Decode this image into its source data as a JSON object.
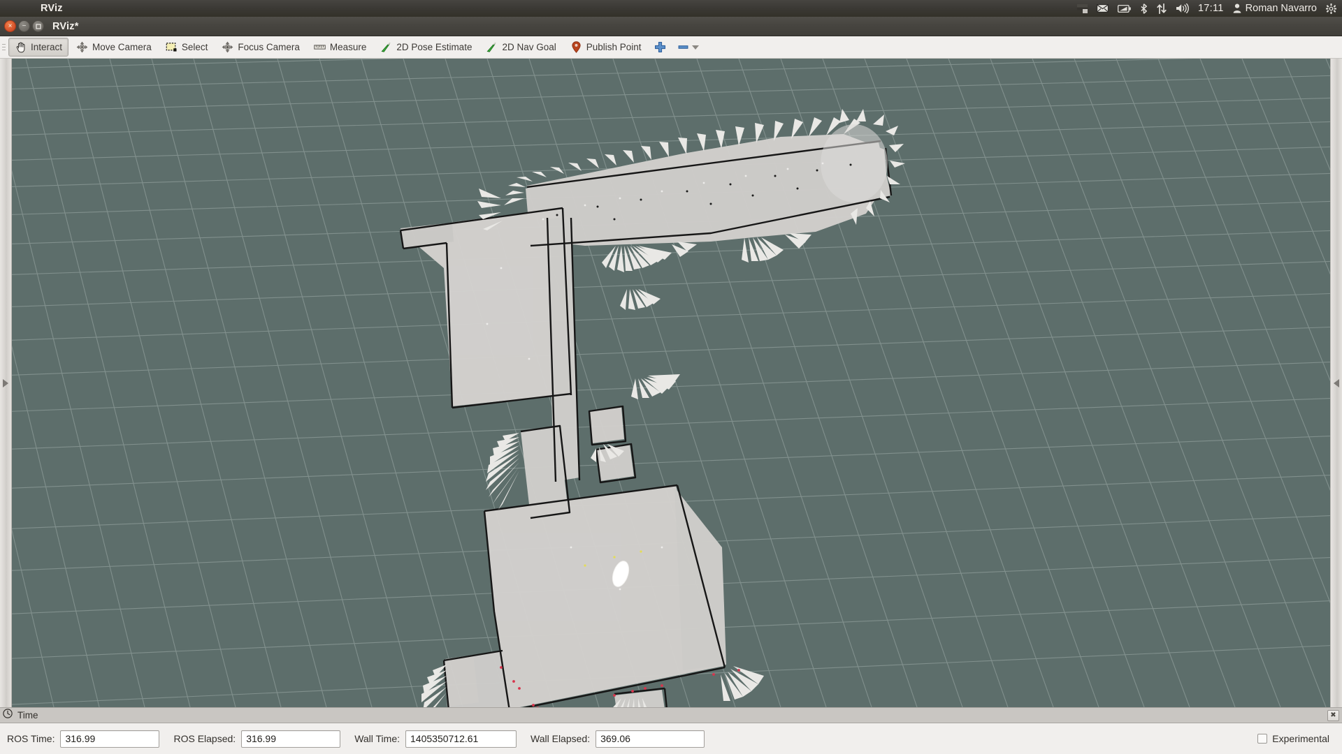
{
  "unity_panel": {
    "app_name": "RViz",
    "tray": {
      "icons": [
        {
          "name": "display-icon",
          "glyph": "display"
        },
        {
          "name": "mail-icon",
          "glyph": "envelope"
        },
        {
          "name": "battery-icon",
          "glyph": "battery"
        },
        {
          "name": "bluetooth-icon",
          "glyph": "bluetooth"
        },
        {
          "name": "network-icon",
          "glyph": "updown-arrows"
        },
        {
          "name": "volume-icon",
          "glyph": "speaker"
        }
      ],
      "clock": "17:11",
      "user_icon": "user-icon",
      "user_name": "Roman Navarro",
      "settings_icon": "gear-icon"
    }
  },
  "window": {
    "title": "RViz*",
    "controls": {
      "close": "×",
      "minimize": "−",
      "maximize": "□"
    }
  },
  "toolbar": {
    "items": [
      {
        "label": "Interact",
        "icon": "hand-cursor-icon",
        "active": true
      },
      {
        "label": "Move Camera",
        "icon": "move-camera-icon",
        "active": false
      },
      {
        "label": "Select",
        "icon": "select-rect-icon",
        "active": false
      },
      {
        "label": "Focus Camera",
        "icon": "focus-camera-icon",
        "active": false
      },
      {
        "label": "Measure",
        "icon": "ruler-icon",
        "active": false
      },
      {
        "label": "2D Pose Estimate",
        "icon": "green-arrow-icon",
        "active": false
      },
      {
        "label": "2D Nav Goal",
        "icon": "green-arrow-icon",
        "active": false
      },
      {
        "label": "Publish Point",
        "icon": "map-pin-icon",
        "active": false
      }
    ],
    "add_tool_icon": "plus-icon",
    "remove_tool_icon": "minus-icon",
    "dropdown_icon": "chevron-down-icon"
  },
  "viewport": {
    "background_color": "#5d6e6b",
    "grid_color": "#8e9c99",
    "map_free_color": "#d2d0cd",
    "map_occupied_color": "#151515",
    "scan_point_color": "#e9e8e5",
    "robot_color": "#ffffff",
    "marker_color": "#d8344c",
    "left_splitter_icon": "chevron-right-icon",
    "right_splitter_icon": "chevron-left-icon"
  },
  "time_panel": {
    "title": "Time",
    "title_icon": "clock-icon",
    "close_icon": "close-icon",
    "fields": [
      {
        "name": "ros-time",
        "label": "ROS Time:",
        "value": "316.99"
      },
      {
        "name": "ros-elapsed",
        "label": "ROS Elapsed:",
        "value": "316.99"
      },
      {
        "name": "wall-time",
        "label": "Wall Time:",
        "value": "1405350712.61"
      },
      {
        "name": "wall-elapsed",
        "label": "Wall Elapsed:",
        "value": "369.06"
      }
    ],
    "experimental": {
      "label": "Experimental",
      "checked": false
    }
  }
}
